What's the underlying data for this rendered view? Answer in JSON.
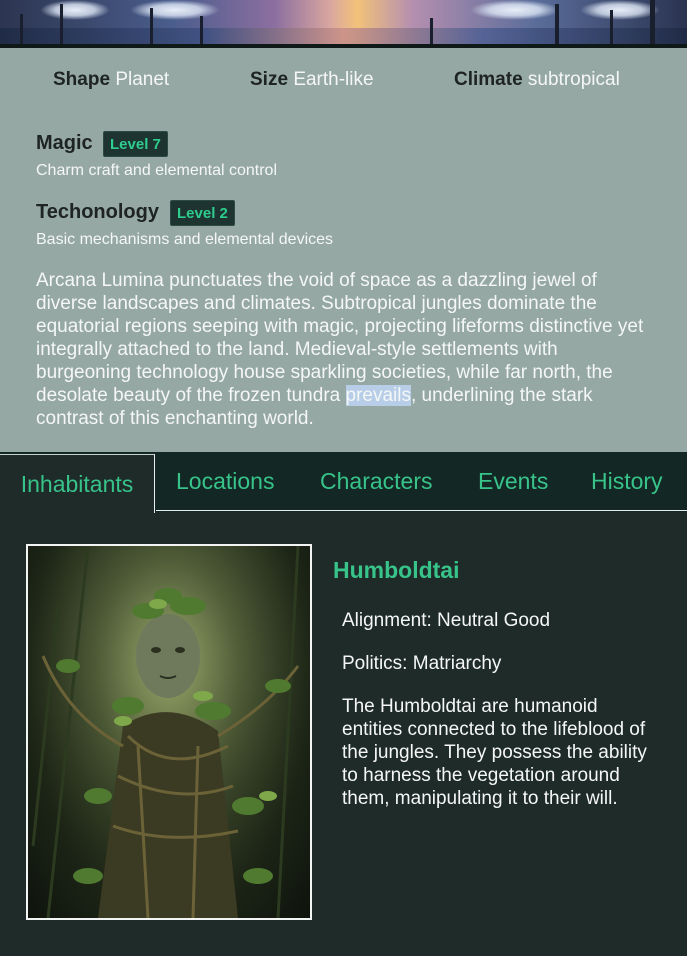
{
  "world": {
    "stats": [
      {
        "label": "Shape",
        "value": "Planet"
      },
      {
        "label": "Size",
        "value": "Earth-like"
      },
      {
        "label": "Climate",
        "value": "subtropical"
      }
    ],
    "magic": {
      "title": "Magic",
      "level": "Level 7",
      "desc": "Charm craft and elemental control"
    },
    "technology": {
      "title": "Techonology",
      "level": "Level 2",
      "desc": "Basic mechanisms and elemental devices"
    },
    "description_before": "Arcana Lumina punctuates the void of space as a dazzling jewel of diverse landscapes and climates. Subtropical jungles dominate the equatorial regions seeping with magic, projecting lifeforms distinctive yet integrally attached to the land. Medieval-style settlements with burgeoning technology house sparkling societies, while far north, the desolate beauty of the frozen tundra ",
    "description_highlight": "prevails",
    "description_after": ", underlining the stark contrast of this enchanting world."
  },
  "tabs": [
    {
      "label": "Inhabitants",
      "active": true
    },
    {
      "label": "Locations"
    },
    {
      "label": "Characters"
    },
    {
      "label": "Events"
    },
    {
      "label": "History"
    }
  ],
  "inhabitant": {
    "name": "Humboldtai",
    "alignment": "Alignment: Neutral Good",
    "politics": "Politics: Matriarchy",
    "description": "The Humboldtai are humanoid entities connected to the lifeblood of the jungles. They possess the ability to harness the vegetation around them, manipulating it to their will.",
    "portrait_icon": "vine-humanoid-portrait"
  },
  "colors": {
    "accent": "#37c38a",
    "panel": "#96a8a4",
    "background": "#1f2b29",
    "tabbar": "#132824"
  }
}
